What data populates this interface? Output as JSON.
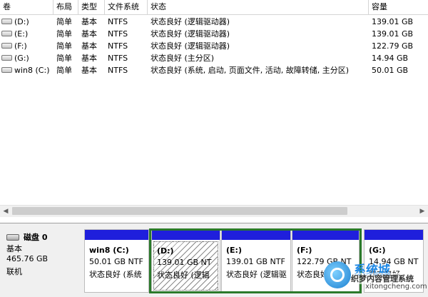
{
  "columns": [
    {
      "key": "volume",
      "label": "卷"
    },
    {
      "key": "layout",
      "label": "布局"
    },
    {
      "key": "type",
      "label": "类型"
    },
    {
      "key": "filesystem",
      "label": "文件系统"
    },
    {
      "key": "status",
      "label": "状态"
    },
    {
      "key": "capacity",
      "label": "容量"
    }
  ],
  "volumes": [
    {
      "volume": "(D:)",
      "layout": "简单",
      "type": "基本",
      "filesystem": "NTFS",
      "status": "状态良好 (逻辑驱动器)",
      "capacity": "139.01 GB"
    },
    {
      "volume": "(E:)",
      "layout": "简单",
      "type": "基本",
      "filesystem": "NTFS",
      "status": "状态良好 (逻辑驱动器)",
      "capacity": "139.01 GB"
    },
    {
      "volume": "(F:)",
      "layout": "简单",
      "type": "基本",
      "filesystem": "NTFS",
      "status": "状态良好 (逻辑驱动器)",
      "capacity": "122.79 GB"
    },
    {
      "volume": "(G:)",
      "layout": "简单",
      "type": "基本",
      "filesystem": "NTFS",
      "status": "状态良好 (主分区)",
      "capacity": "14.94 GB"
    },
    {
      "volume": "win8 (C:)",
      "layout": "简单",
      "type": "基本",
      "filesystem": "NTFS",
      "status": "状态良好 (系统, 启动, 页面文件, 活动, 故障转储, 主分区)",
      "capacity": "50.01 GB"
    }
  ],
  "disk": {
    "name": "磁盘 0",
    "type": "基本",
    "size": "465.76 GB",
    "state": "联机"
  },
  "partitions": [
    {
      "label": "win8  (C:)",
      "size": "50.01 GB NTF",
      "status": "状态良好 (系统"
    },
    {
      "label": "(D:)",
      "size": "139.01 GB NT",
      "status": "状态良好 (逻辑"
    },
    {
      "label": "(E:)",
      "size": "139.01 GB NTF",
      "status": "状态良好 (逻辑驱"
    },
    {
      "label": "(F:)",
      "size": "122.79 GB NT",
      "status": "状态良好 (逻辑"
    },
    {
      "label": "(G:)",
      "size": "14.94 GB NT",
      "status": "状态良好"
    }
  ],
  "watermark": {
    "line1": "系统城",
    "line2": "织梦内容管理系统",
    "line3": "xitongcheng.com"
  },
  "icons": {
    "scroll_left": "scroll-left-arrow-icon",
    "scroll_right": "scroll-right-arrow-icon",
    "drive": "drive-icon",
    "disk": "disk-icon"
  },
  "colors": {
    "partition_bar": "#1f1fdc",
    "extended_border": "#2b7a2b",
    "selected_hatch": "#8a8a8a"
  }
}
